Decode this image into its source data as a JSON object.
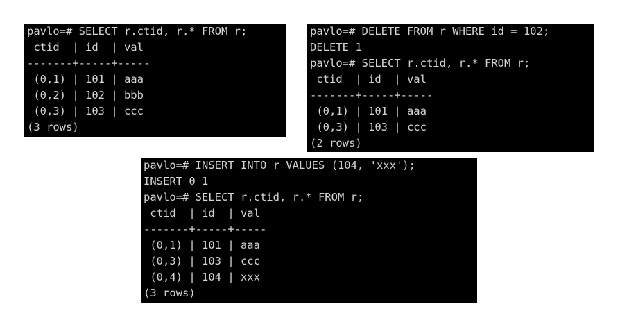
{
  "terminals": [
    {
      "lines": [
        "pavlo=# SELECT r.ctid, r.* FROM r;",
        " ctid  | id  | val",
        "-------+-----+-----",
        " (0,1) | 101 | aaa",
        " (0,2) | 102 | bbb",
        " (0,3) | 103 | ccc",
        "(3 rows)"
      ]
    },
    {
      "lines": [
        "pavlo=# DELETE FROM r WHERE id = 102;",
        "DELETE 1",
        "pavlo=# SELECT r.ctid, r.* FROM r;",
        " ctid  | id  | val",
        "-------+-----+-----",
        " (0,1) | 101 | aaa",
        " (0,3) | 103 | ccc",
        "(2 rows)"
      ]
    },
    {
      "lines": [
        "pavlo=# INSERT INTO r VALUES (104, 'xxx');",
        "INSERT 0 1",
        "pavlo=# SELECT r.ctid, r.* FROM r;",
        " ctid  | id  | val",
        "-------+-----+-----",
        " (0,1) | 101 | aaa",
        " (0,3) | 103 | ccc",
        " (0,4) | 104 | xxx",
        "(3 rows)"
      ]
    }
  ]
}
